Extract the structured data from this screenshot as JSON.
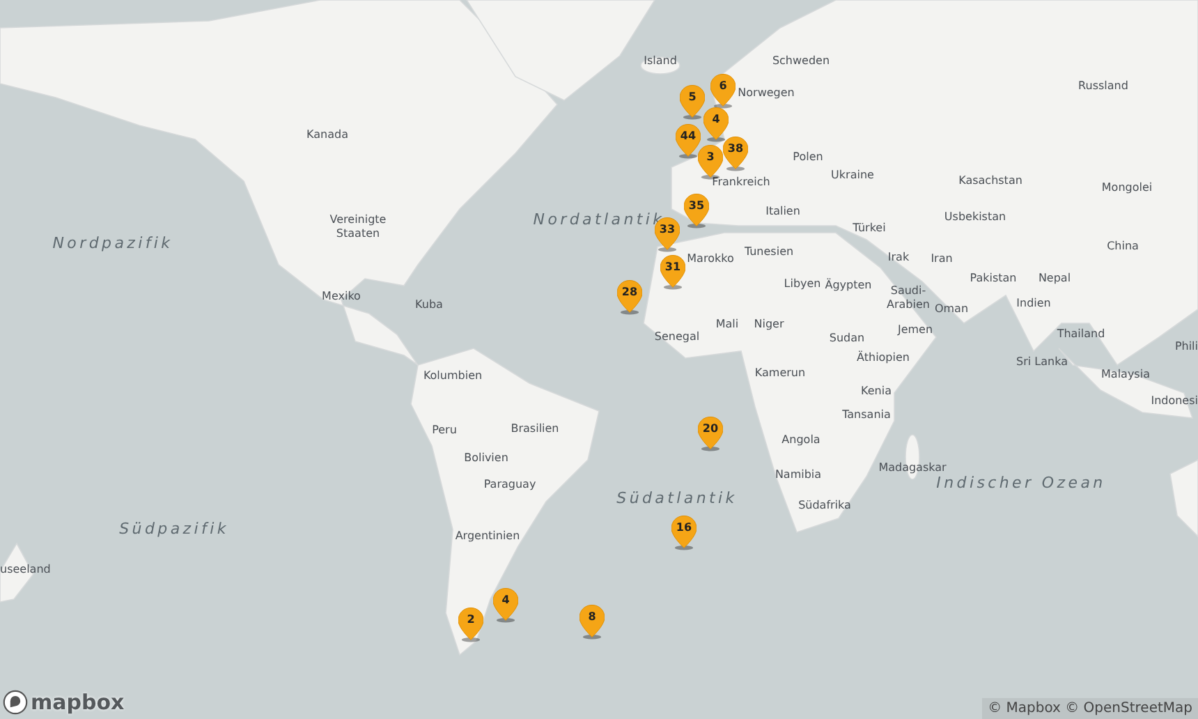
{
  "map": {
    "labels": [
      {
        "text": "Island",
        "kind": "place"
      },
      {
        "text": "Schweden",
        "kind": "place"
      },
      {
        "text": "Norwegen",
        "kind": "place"
      },
      {
        "text": "Russland",
        "kind": "place"
      },
      {
        "text": "Kanada",
        "kind": "place"
      },
      {
        "text": "Polen",
        "kind": "place"
      },
      {
        "text": "Ukraine",
        "kind": "place"
      },
      {
        "text": "Kasachstan",
        "kind": "place"
      },
      {
        "text": "Mongolei",
        "kind": "place"
      },
      {
        "text": "Frankreich",
        "kind": "place"
      },
      {
        "text": "Italien",
        "kind": "place"
      },
      {
        "text": "Vereinigte Staaten",
        "kind": "place"
      },
      {
        "text": "Nordatlantik",
        "kind": "ocean"
      },
      {
        "text": "Nordpazifik",
        "kind": "ocean"
      },
      {
        "text": "Türkei",
        "kind": "place"
      },
      {
        "text": "Usbekistan",
        "kind": "place"
      },
      {
        "text": "China",
        "kind": "place"
      },
      {
        "text": "Tunesien",
        "kind": "place"
      },
      {
        "text": "Marokko",
        "kind": "place"
      },
      {
        "text": "Irak",
        "kind": "place"
      },
      {
        "text": "Iran",
        "kind": "place"
      },
      {
        "text": "Pakistan",
        "kind": "place"
      },
      {
        "text": "Nepal",
        "kind": "place"
      },
      {
        "text": "Libyen",
        "kind": "place"
      },
      {
        "text": "Ägypten",
        "kind": "place"
      },
      {
        "text": "Saudi-Arabien",
        "kind": "place"
      },
      {
        "text": "Oman",
        "kind": "place"
      },
      {
        "text": "Indien",
        "kind": "place"
      },
      {
        "text": "Mexiko",
        "kind": "place"
      },
      {
        "text": "Kuba",
        "kind": "place"
      },
      {
        "text": "Senegal",
        "kind": "place"
      },
      {
        "text": "Mali",
        "kind": "place"
      },
      {
        "text": "Niger",
        "kind": "place"
      },
      {
        "text": "Sudan",
        "kind": "place"
      },
      {
        "text": "Jemen",
        "kind": "place"
      },
      {
        "text": "Thailand",
        "kind": "place"
      },
      {
        "text": "Phili",
        "kind": "place"
      },
      {
        "text": "Äthiopien",
        "kind": "place"
      },
      {
        "text": "Sri Lanka",
        "kind": "place"
      },
      {
        "text": "Kolumbien",
        "kind": "place"
      },
      {
        "text": "Kamerun",
        "kind": "place"
      },
      {
        "text": "Malaysia",
        "kind": "place"
      },
      {
        "text": "Indonesi",
        "kind": "place"
      },
      {
        "text": "Kenia",
        "kind": "place"
      },
      {
        "text": "Tansania",
        "kind": "place"
      },
      {
        "text": "Peru",
        "kind": "place"
      },
      {
        "text": "Brasilien",
        "kind": "place"
      },
      {
        "text": "Angola",
        "kind": "place"
      },
      {
        "text": "Madagaskar",
        "kind": "place"
      },
      {
        "text": "Bolivien",
        "kind": "place"
      },
      {
        "text": "Paraguay",
        "kind": "place"
      },
      {
        "text": "Namibia",
        "kind": "place"
      },
      {
        "text": "Südatlantik",
        "kind": "ocean"
      },
      {
        "text": "Indischer Ozean",
        "kind": "ocean"
      },
      {
        "text": "Südafrika",
        "kind": "place"
      },
      {
        "text": "Südpazifik",
        "kind": "ocean"
      },
      {
        "text": "Argentinien",
        "kind": "place"
      },
      {
        "text": "useeland",
        "kind": "place"
      }
    ]
  },
  "markers": [
    {
      "label": "6"
    },
    {
      "label": "5"
    },
    {
      "label": "4"
    },
    {
      "label": "44"
    },
    {
      "label": "3"
    },
    {
      "label": "38"
    },
    {
      "label": "35"
    },
    {
      "label": "33"
    },
    {
      "label": "31"
    },
    {
      "label": "28"
    },
    {
      "label": "20"
    },
    {
      "label": "16"
    },
    {
      "label": "8"
    },
    {
      "label": "4"
    },
    {
      "label": "2"
    }
  ],
  "logo": {
    "text": "mapbox"
  },
  "attribution": "© Mapbox © OpenStreetMap"
}
